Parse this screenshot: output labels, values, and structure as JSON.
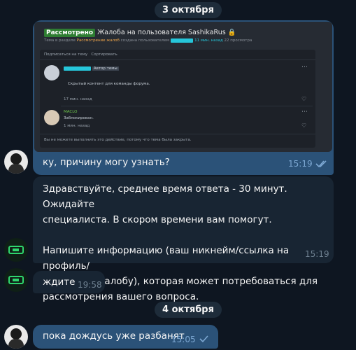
{
  "dates": {
    "oct3": "3 октября",
    "oct4": "4 октября"
  },
  "screenshot": {
    "status_badge": "Рассмотрено",
    "title": "Жалоба на пользователя SashikaRus",
    "lock_icon": "lock-icon",
    "meta_prefix": "Тема в разделе",
    "meta_section": "Рассмотрение жалоб",
    "meta_created": "создана пользователем",
    "meta_time": "11 мин. назад",
    "meta_views": "22 просмотра",
    "subscribe": "Подписаться на тему",
    "sort": "Сортировать",
    "post1_badge": "Автор темы",
    "post1_text": "Скрытый контент для команды форума.",
    "post1_time": "17 мин. назад",
    "post2_user": "MACLO",
    "post2_text": "Заблокирован.",
    "post2_time": "1 мин. назад",
    "footer_note": "Вы не можете выполнить это действие, потому что тема была закрыта."
  },
  "messages": [
    {
      "text": "ку, причину могу узнать?",
      "time": "15:19"
    },
    {
      "text": "Здравствуйте, среднее время ответа - 30 минут. Ожидайте\nспециалиста. В скором времени вам помогут.\n\nНапишите информацию (ваш никнейм/ссылка на профиль/\nссылка на жалобу), которая может потребоваться для\nрассмотрения вашего вопроса.",
      "time": "15:19"
    },
    {
      "text": "ждите",
      "time": "19:58"
    },
    {
      "text": "пока дождусь уже разбанят",
      "time": "15:05"
    }
  ],
  "colors": {
    "background": "#0e1621",
    "outgoing_bubble": "#2b5278",
    "incoming_bubble": "#182533",
    "date_pill": "#1e2c3a"
  }
}
